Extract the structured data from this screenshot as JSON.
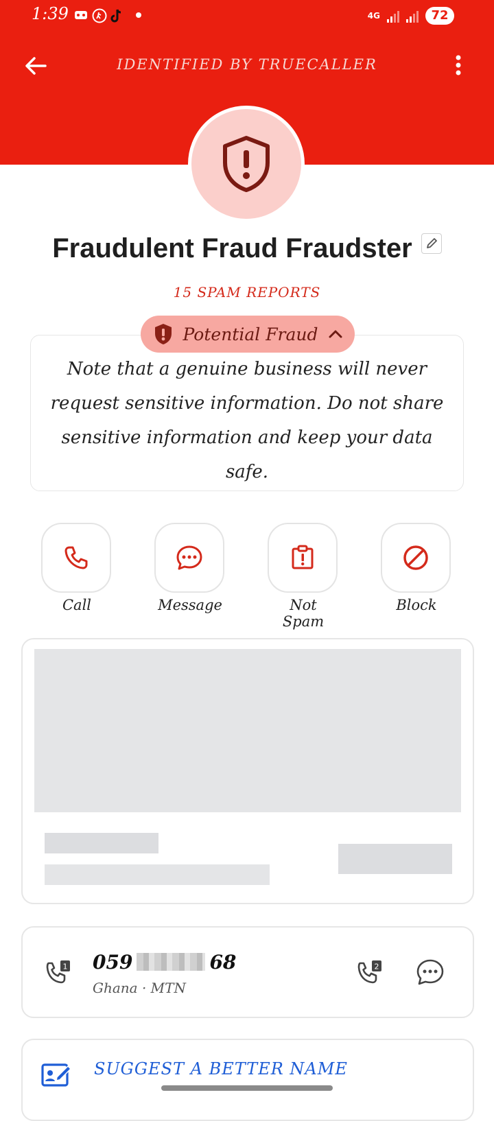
{
  "status_bar": {
    "time": "1:39",
    "network": "4G",
    "battery": "72"
  },
  "header": {
    "title": "IDENTIFIED BY TRUECALLER",
    "back_icon": "arrow-left-icon",
    "menu_icon": "more-vertical-icon",
    "color": "#ea1f10"
  },
  "caller": {
    "name": "Fraudulent Fraud Fraudster",
    "spam_reports": "15 SPAM REPORTS",
    "avatar_icon": "shield-alert-icon"
  },
  "fraud_warning": {
    "badge_label": "Potential Fraud",
    "note": "Note that a genuine business will never request sensitive information. Do not share sensitive information and keep your data safe."
  },
  "actions": [
    {
      "label": "Call",
      "icon": "phone-icon"
    },
    {
      "label": "Message",
      "icon": "chat-bubble-icon"
    },
    {
      "label": "Not Spam",
      "icon": "clipboard-alert-icon"
    },
    {
      "label": "Block",
      "icon": "block-icon"
    }
  ],
  "number": {
    "prefix": "059",
    "suffix": "68",
    "carrier": "Ghana · MTN"
  },
  "suggest": {
    "label": "SUGGEST A BETTER NAME"
  },
  "colors": {
    "accent": "#ea1f10",
    "icon_red": "#d42a1b",
    "link_blue": "#1f5ed6"
  }
}
